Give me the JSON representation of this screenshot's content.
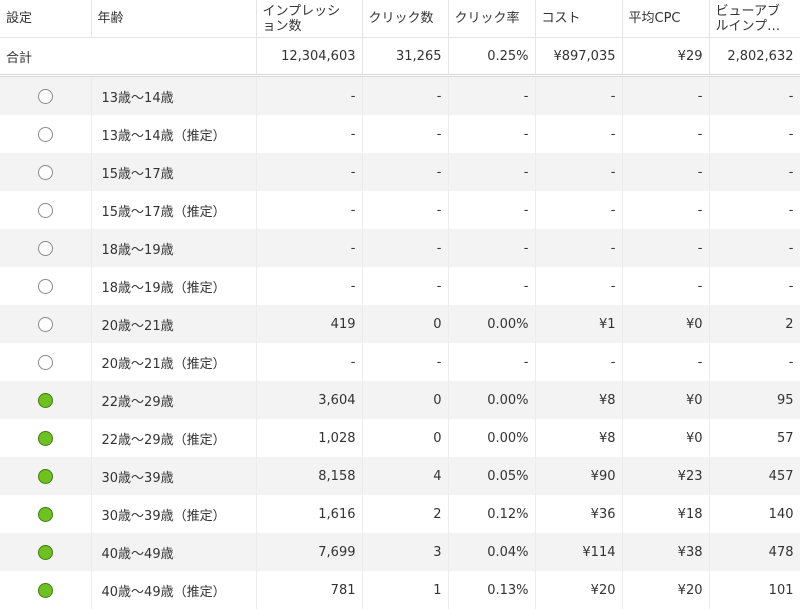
{
  "colors": {
    "active": "#6ec21f",
    "active_border": "#3f7a12",
    "inactive_border": "#8a8a8a"
  },
  "header": {
    "setting": "設定",
    "age": "年齢",
    "impressions": [
      "インプレッシ",
      "ョン数"
    ],
    "clicks": "クリック数",
    "ctr": "クリック率",
    "cost": "コスト",
    "avg_cpc": "平均CPC",
    "viewable_impressions": [
      "ビューアブ",
      "ルインプ…"
    ]
  },
  "total": {
    "label": "合計",
    "impressions": "12,304,603",
    "clicks": "31,265",
    "ctr": "0.25%",
    "cost": "¥897,035",
    "avg_cpc": "¥29",
    "viewable_impressions": "2,802,632"
  },
  "rows": [
    {
      "status": "off",
      "age": "13歳～14歳",
      "impressions": "-",
      "clicks": "-",
      "ctr": "-",
      "cost": "-",
      "avg_cpc": "-",
      "viewable": "-"
    },
    {
      "status": "off",
      "age": "13歳～14歳（推定）",
      "impressions": "-",
      "clicks": "-",
      "ctr": "-",
      "cost": "-",
      "avg_cpc": "-",
      "viewable": "-"
    },
    {
      "status": "off",
      "age": "15歳～17歳",
      "impressions": "-",
      "clicks": "-",
      "ctr": "-",
      "cost": "-",
      "avg_cpc": "-",
      "viewable": "-"
    },
    {
      "status": "off",
      "age": "15歳～17歳（推定）",
      "impressions": "-",
      "clicks": "-",
      "ctr": "-",
      "cost": "-",
      "avg_cpc": "-",
      "viewable": "-"
    },
    {
      "status": "off",
      "age": "18歳～19歳",
      "impressions": "-",
      "clicks": "-",
      "ctr": "-",
      "cost": "-",
      "avg_cpc": "-",
      "viewable": "-"
    },
    {
      "status": "off",
      "age": "18歳～19歳（推定）",
      "impressions": "-",
      "clicks": "-",
      "ctr": "-",
      "cost": "-",
      "avg_cpc": "-",
      "viewable": "-"
    },
    {
      "status": "off",
      "age": "20歳～21歳",
      "impressions": "419",
      "clicks": "0",
      "ctr": "0.00%",
      "cost": "¥1",
      "avg_cpc": "¥0",
      "viewable": "2"
    },
    {
      "status": "off",
      "age": "20歳～21歳（推定）",
      "impressions": "-",
      "clicks": "-",
      "ctr": "-",
      "cost": "-",
      "avg_cpc": "-",
      "viewable": "-"
    },
    {
      "status": "on",
      "age": "22歳～29歳",
      "impressions": "3,604",
      "clicks": "0",
      "ctr": "0.00%",
      "cost": "¥8",
      "avg_cpc": "¥0",
      "viewable": "95"
    },
    {
      "status": "on",
      "age": "22歳～29歳（推定）",
      "impressions": "1,028",
      "clicks": "0",
      "ctr": "0.00%",
      "cost": "¥8",
      "avg_cpc": "¥0",
      "viewable": "57"
    },
    {
      "status": "on",
      "age": "30歳～39歳",
      "impressions": "8,158",
      "clicks": "4",
      "ctr": "0.05%",
      "cost": "¥90",
      "avg_cpc": "¥23",
      "viewable": "457"
    },
    {
      "status": "on",
      "age": "30歳～39歳（推定）",
      "impressions": "1,616",
      "clicks": "2",
      "ctr": "0.12%",
      "cost": "¥36",
      "avg_cpc": "¥18",
      "viewable": "140"
    },
    {
      "status": "on",
      "age": "40歳～49歳",
      "impressions": "7,699",
      "clicks": "3",
      "ctr": "0.04%",
      "cost": "¥114",
      "avg_cpc": "¥38",
      "viewable": "478"
    },
    {
      "status": "on",
      "age": "40歳～49歳（推定）",
      "impressions": "781",
      "clicks": "1",
      "ctr": "0.13%",
      "cost": "¥20",
      "avg_cpc": "¥20",
      "viewable": "101"
    }
  ]
}
